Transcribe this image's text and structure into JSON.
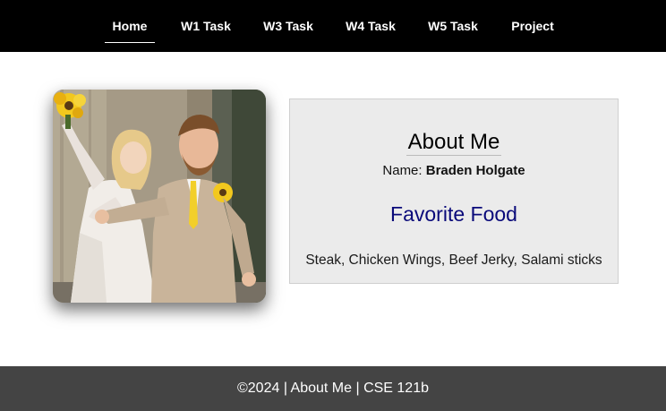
{
  "nav": {
    "items": [
      {
        "label": "Home",
        "active": true
      },
      {
        "label": "W1 Task",
        "active": false
      },
      {
        "label": "W3 Task",
        "active": false
      },
      {
        "label": "W4 Task",
        "active": false
      },
      {
        "label": "W5 Task",
        "active": false
      },
      {
        "label": "Project",
        "active": false
      }
    ]
  },
  "about": {
    "title": "About Me",
    "name_label": "Name:",
    "name_value": "Braden Holgate",
    "food_title": "Favorite Food",
    "food_list": "Steak, Chicken Wings, Beef Jerky, Salami sticks"
  },
  "footer": {
    "text": "©2024 | About Me | CSE 121b"
  },
  "colors": {
    "nav_bg": "#000000",
    "card_bg": "#ebebeb",
    "food_title": "#0a0a7a",
    "footer_bg": "#444444"
  }
}
